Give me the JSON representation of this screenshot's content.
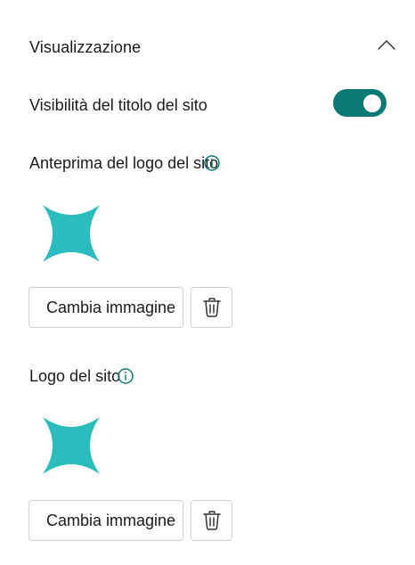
{
  "section": {
    "title": "Visualizzazione",
    "collapse_icon": "chevron-up-icon"
  },
  "site_title_visibility": {
    "label": "Visibilità del titolo del sito",
    "enabled": true,
    "toggle_color": "#0b7a75"
  },
  "logo_preview": {
    "label": "Anteprima del logo del sito",
    "info_icon": "info-icon",
    "logo_icon": "four-point-star-logo",
    "logo_color": "#2bbcbe",
    "change_label": "Cambia immagine",
    "delete_icon": "trash-icon"
  },
  "site_logo": {
    "label": "Logo del sito",
    "info_icon": "info-icon",
    "logo_icon": "four-point-star-logo",
    "logo_color": "#2bbcbe",
    "change_label": "Cambia immagine",
    "delete_icon": "trash-icon"
  }
}
